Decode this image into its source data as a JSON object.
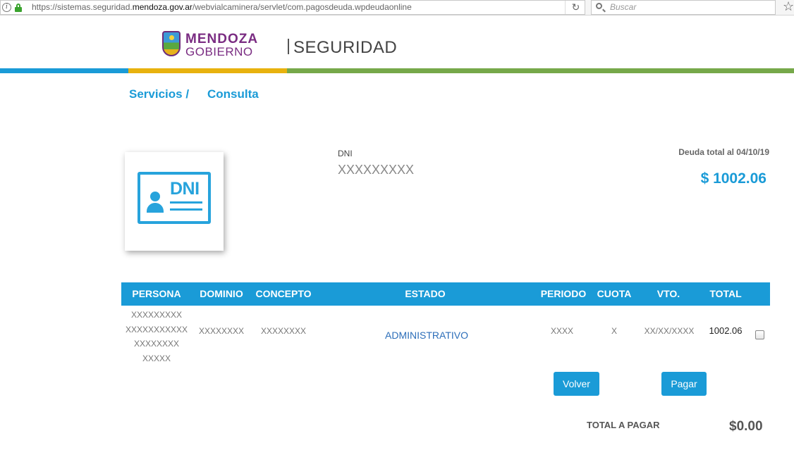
{
  "browser": {
    "url_prefix": "https://sistemas.seguridad.",
    "url_domain": "mendoza.gov.ar",
    "url_suffix": "/webvialcaminera/servlet/com.pagosdeuda.wpdeudaonline",
    "search_placeholder": "Buscar"
  },
  "header": {
    "logo_line1": "MENDOZA",
    "logo_line2": "GOBIERNO",
    "section": "SEGURIDAD"
  },
  "colors": {
    "accent": "#1a9bd7",
    "stripe_yellow": "#e8b20e",
    "stripe_green": "#76a84a",
    "brand_purple": "#7a2c82"
  },
  "breadcrumb": {
    "item1": "Servicios /",
    "item2": "Consulta"
  },
  "card": {
    "icon_text": "DNI"
  },
  "info": {
    "dni_label": "DNI",
    "dni_value": "XXXXXXXXX",
    "deuda_label": "Deuda total al 04/10/19",
    "deuda_value": "$ 1002.06"
  },
  "table": {
    "headers": [
      "PERSONA",
      "DOMINIO",
      "CONCEPTO",
      "ESTADO",
      "PERIODO",
      "CUOTA",
      "VTO.",
      "TOTAL"
    ],
    "row": {
      "persona": [
        "XXXXXXXXX",
        "XXXXXXXXXXX",
        "XXXXXXXX",
        "XXXXX"
      ],
      "dominio": "XXXXXXXX",
      "concepto": "XXXXXXXX",
      "estado": "ADMINISTRATIVO",
      "periodo": "XXXX",
      "cuota": "X",
      "vto": "XX/XX/XXXX",
      "total": "1002.06"
    }
  },
  "buttons": {
    "volver": "Volver",
    "pagar": "Pagar"
  },
  "footer": {
    "total_label": "TOTAL A PAGAR",
    "total_value": "$0.00"
  }
}
